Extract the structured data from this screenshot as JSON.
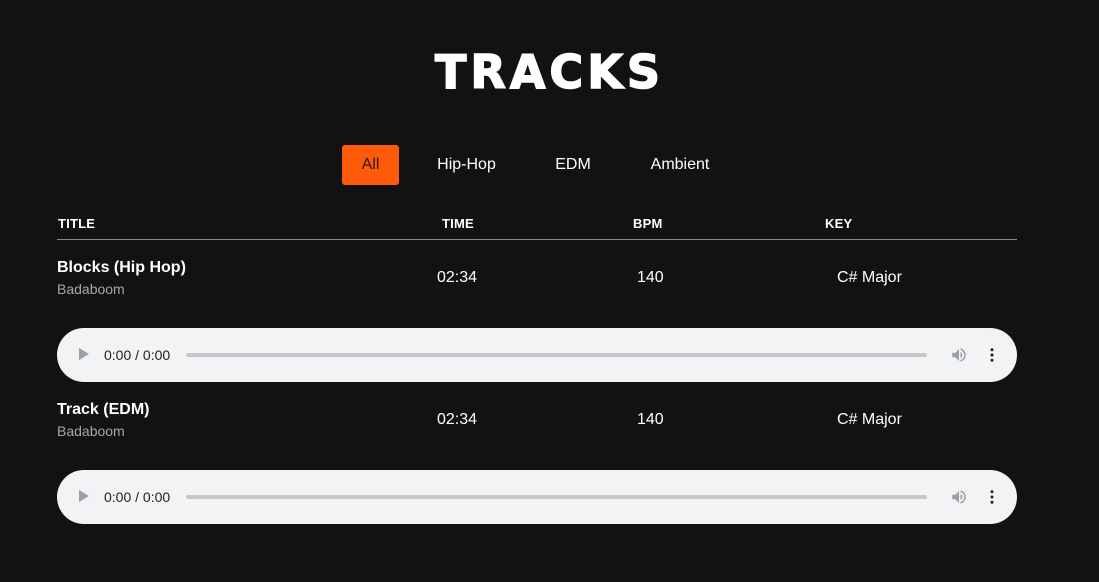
{
  "page": {
    "title": "TRACKS"
  },
  "filters": [
    {
      "label": "All",
      "active": true
    },
    {
      "label": "Hip-Hop",
      "active": false
    },
    {
      "label": "EDM",
      "active": false
    },
    {
      "label": "Ambient",
      "active": false
    }
  ],
  "columns": {
    "title": "TITLE",
    "time": "TIME",
    "bpm": "BPM",
    "key": "KEY"
  },
  "tracks": [
    {
      "title": "Blocks (Hip Hop)",
      "artist": "Badaboom",
      "time": "02:34",
      "bpm": "140",
      "key": "C# Major",
      "player": {
        "time_display": "0:00 / 0:00",
        "progress": 0
      }
    },
    {
      "title": "Track (EDM)",
      "artist": "Badaboom",
      "time": "02:34",
      "bpm": "140",
      "key": "C# Major",
      "player": {
        "time_display": "0:00 / 0:00",
        "progress": 0
      }
    }
  ],
  "colors": {
    "background": "#121212",
    "accent": "#ff5a0a",
    "player_bg": "#f1f3f4"
  },
  "icons": {
    "play": "play-icon",
    "volume": "volume-icon",
    "more": "more-vertical-icon"
  }
}
